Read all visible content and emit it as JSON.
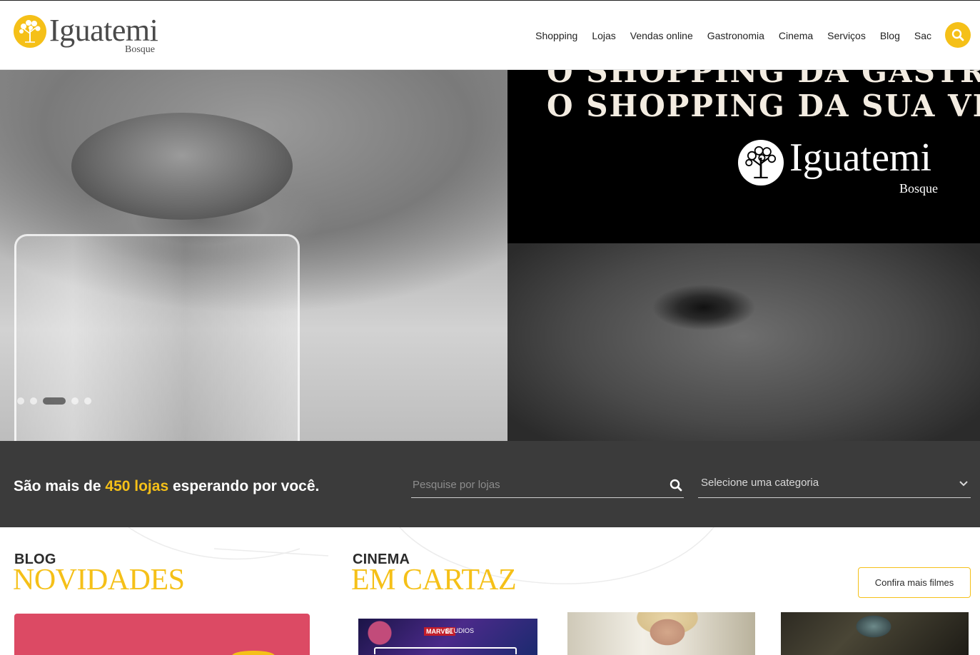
{
  "header": {
    "logo": {
      "name": "Iguatemi",
      "sub": "Bosque"
    },
    "nav": [
      "Shopping",
      "Lojas",
      "Vendas online",
      "Gastronomia",
      "Cinema",
      "Serviços",
      "Blog",
      "Sac"
    ],
    "search_icon": "search-icon",
    "colors": {
      "accent": "#f5c018"
    }
  },
  "hero": {
    "line1": "O SHOPPING DA GASTRONOMIA",
    "line2": "O SHOPPING DA SUA VIDA",
    "logo": {
      "name": "Iguatemi",
      "sub": "Bosque"
    },
    "slides_total": 5,
    "active_slide": 3
  },
  "stores": {
    "text_before": "São mais de ",
    "highlight": "450 lojas",
    "text_after": " esperando por você.",
    "search_placeholder": "Pesquise por lojas",
    "category_label": "Selecione uma categoria",
    "colors": {
      "band": "#3b3b3b"
    }
  },
  "blog": {
    "kicker": "BLOG",
    "title": "NOVIDADES"
  },
  "cinema": {
    "kicker": "CINEMA",
    "title": "EM CARTAZ",
    "more_button": "Confira mais filmes",
    "movie1_brand": "MARVEL",
    "movie1_brand2": "STUDIOS"
  }
}
